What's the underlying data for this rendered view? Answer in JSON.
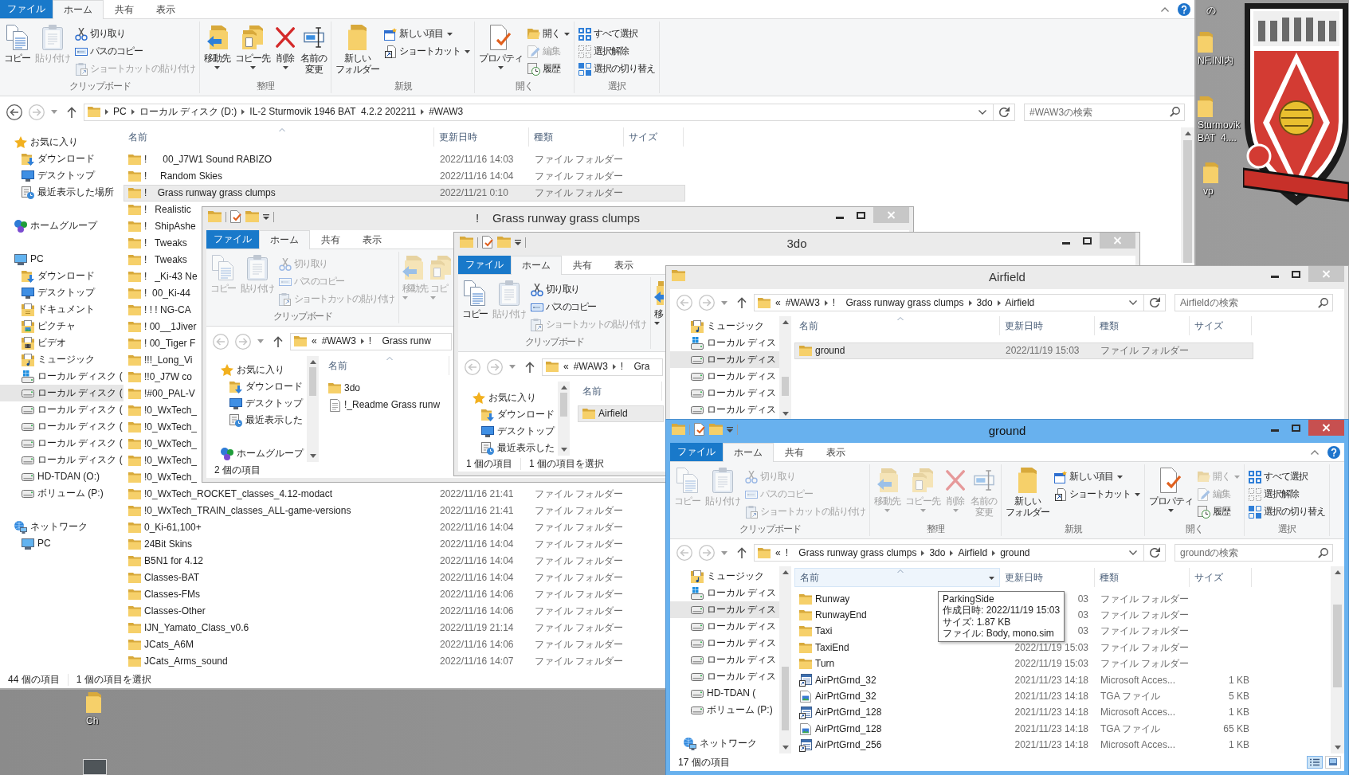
{
  "desktop": {
    "icons": [
      {
        "kind": "label",
        "label": "の"
      },
      {
        "kind": "folder",
        "label": "NF.INI内"
      },
      {
        "kind": "folder",
        "label": "Sturmovik\nBAT  4...."
      },
      {
        "kind": "folder",
        "label": "vp"
      },
      {
        "kind": "folder",
        "label": "Ch"
      },
      {
        "kind": "image"
      }
    ]
  },
  "windows": [
    {
      "active": false,
      "tabs": [
        {
          "kind": "file",
          "label": "ファイル",
          "selected": false
        },
        {
          "kind": "tab",
          "label": "ホーム",
          "selected": true
        },
        {
          "kind": "tab",
          "label": "共有",
          "selected": false
        },
        {
          "kind": "tab",
          "label": "表示",
          "selected": false
        }
      ],
      "ribbon": [
        {
          "label": "クリップボード",
          "items": [
            {
              "kind": "copy",
              "label": "コピー",
              "disabled": false
            },
            {
              "kind": "paste",
              "label": "貼り付け",
              "disabled": true
            },
            {
              "kind": "cut",
              "label": "切り取り",
              "disabled": false
            },
            {
              "kind": "copypath",
              "label": "パスのコピー",
              "disabled": false
            },
            {
              "kind": "pasteshortcut",
              "label": "ショートカットの貼り付け",
              "disabled": true
            }
          ]
        },
        {
          "label": "整理",
          "items": [
            {
              "kind": "moveto",
              "label": "移動先",
              "disabled": false
            },
            {
              "kind": "copyto",
              "label": "コピー先",
              "disabled": false
            },
            {
              "kind": "delete",
              "label": "削除",
              "disabled": false
            },
            {
              "kind": "rename",
              "lines": [
                "名前の",
                "変更"
              ],
              "disabled": false
            }
          ]
        },
        {
          "label": "新規",
          "items": [
            {
              "kind": "newfolder",
              "lines": [
                "新しい",
                "フォルダー"
              ],
              "disabled": false
            },
            {
              "kind": "newitem",
              "label": "新しい項目",
              "disabled": false
            },
            {
              "kind": "shortcut",
              "label": "ショートカット",
              "disabled": false
            }
          ]
        },
        {
          "label": "開く",
          "items": [
            {
              "kind": "properties",
              "label": "プロパティ",
              "disabled": false
            },
            {
              "kind": "open",
              "label": "開く",
              "disabled": false
            },
            {
              "kind": "edit",
              "label": "編集",
              "disabled": true
            },
            {
              "kind": "history",
              "label": "履歴",
              "disabled": false
            }
          ]
        },
        {
          "label": "選択",
          "items": [
            {
              "kind": "selectall",
              "label": "すべて選択",
              "disabled": false
            },
            {
              "kind": "selectnone",
              "label": "選択解除",
              "disabled": false
            },
            {
              "kind": "invert",
              "label": "選択の切り替え",
              "disabled": false
            }
          ]
        }
      ],
      "nav_buttons": [
        {
          "kind": "back",
          "disabled": false
        },
        {
          "kind": "forward",
          "disabled": true
        }
      ],
      "address": {
        "path": [
          "PC",
          "ローカル ディスク (D:)",
          "IL-2 Sturmovik 1946 BAT  4.2.2 202211",
          "#WAW3"
        ],
        "search_placeholder": "#WAW3の検索"
      },
      "nav": [
        {
          "label": "お気に入り",
          "kind": "favorites",
          "selected": false,
          "children": [
            {
              "label": "ダウンロード",
              "kind": "downloads",
              "selected": false
            },
            {
              "label": "デスクトップ",
              "kind": "desktop",
              "selected": false
            },
            {
              "label": "最近表示した場所",
              "kind": "recent",
              "selected": false
            }
          ]
        },
        {
          "label": "ホームグループ",
          "kind": "homegroup",
          "selected": false
        },
        {
          "label": "PC",
          "kind": "pc",
          "selected": false,
          "children": [
            {
              "label": "ダウンロード",
              "kind": "downloads",
              "selected": false
            },
            {
              "label": "デスクトップ",
              "kind": "desktop",
              "selected": false
            },
            {
              "label": "ドキュメント",
              "kind": "documents",
              "selected": false
            },
            {
              "label": "ピクチャ",
              "kind": "pictures",
              "selected": false
            },
            {
              "label": "ビデオ",
              "kind": "videos",
              "selected": false
            },
            {
              "label": "ミュージック",
              "kind": "music",
              "selected": false
            },
            {
              "label": "ローカル ディスク (",
              "kind": "sysdrive",
              "selected": false
            },
            {
              "label": "ローカル ディスク (",
              "kind": "drive",
              "selected": true
            },
            {
              "label": "ローカル ディスク (",
              "kind": "drive",
              "selected": false
            },
            {
              "label": "ローカル ディスク (",
              "kind": "drive",
              "selected": false
            },
            {
              "label": "ローカル ディスク (",
              "kind": "drive",
              "selected": false
            },
            {
              "label": "ローカル ディスク (",
              "kind": "drive",
              "selected": false
            },
            {
              "label": "HD-TDAN (O:)",
              "kind": "drive",
              "selected": false
            },
            {
              "label": "ボリューム (P:)",
              "kind": "drive",
              "selected": false
            }
          ]
        },
        {
          "label": "ネットワーク",
          "kind": "network",
          "selected": false,
          "children": [
            {
              "label": "PC",
              "kind": "pc",
              "selected": false
            }
          ]
        }
      ],
      "columns": [
        {
          "label": "名前",
          "sorted": true
        },
        {
          "label": "更新日時",
          "sorted": false
        },
        {
          "label": "種類",
          "sorted": false
        },
        {
          "label": "サイズ",
          "sorted": false
        }
      ],
      "rows": [
        {
          "name": "!      00_J7W1 Sound RABIZO",
          "modified": "2022/11/16 14:03",
          "type": "ファイル フォルダー",
          "kind": "folder",
          "selected": false
        },
        {
          "name": "!     Random Skies",
          "modified": "2022/11/16 14:04",
          "type": "ファイル フォルダー",
          "kind": "folder",
          "selected": false
        },
        {
          "name": "!    Grass runway grass clumps",
          "modified": "2022/11/21 0:10",
          "type": "ファイル フォルダー",
          "kind": "folder",
          "selected": true
        },
        {
          "name": "!   Realistic",
          "kind": "folder",
          "selected": false
        },
        {
          "name": "!   ShipAshe",
          "kind": "folder",
          "selected": false
        },
        {
          "name": "!   Tweaks",
          "kind": "folder",
          "selected": false
        },
        {
          "name": "!   Tweaks",
          "kind": "folder",
          "selected": false
        },
        {
          "name": "!   _Ki-43 Ne",
          "kind": "folder",
          "selected": false
        },
        {
          "name": "!  00_Ki-44",
          "kind": "folder",
          "selected": false
        },
        {
          "name": "! ! ! NG-CA",
          "kind": "folder",
          "selected": false
        },
        {
          "name": "! 00__1Jiver",
          "kind": "folder",
          "selected": false
        },
        {
          "name": "! 00_Tiger F",
          "kind": "folder",
          "selected": false
        },
        {
          "name": "!!!_Long_Vi",
          "kind": "folder",
          "selected": false
        },
        {
          "name": "!!0_J7W co",
          "kind": "folder",
          "selected": false
        },
        {
          "name": "!#00_PAL-V",
          "kind": "folder",
          "selected": false
        },
        {
          "name": "!0_WxTech_",
          "kind": "folder",
          "selected": false
        },
        {
          "name": "!0_WxTech_",
          "kind": "folder",
          "selected": false
        },
        {
          "name": "!0_WxTech_",
          "kind": "folder",
          "selected": false
        },
        {
          "name": "!0_WxTech_",
          "kind": "folder",
          "selected": false
        },
        {
          "name": "!0_WxTech_",
          "kind": "folder",
          "selected": false
        },
        {
          "name": "!0_WxTech_ROCKET_classes_4.12-modact",
          "modified": "2022/11/16 21:41",
          "type": "ファイル フォルダー",
          "kind": "folder",
          "selected": false
        },
        {
          "name": "!0_WxTech_TRAIN_classes_ALL-game-versions",
          "modified": "2022/11/16 21:41",
          "type": "ファイル フォルダー",
          "kind": "folder",
          "selected": false
        },
        {
          "name": "0_Ki-61,100+",
          "modified": "2022/11/16 14:04",
          "type": "ファイル フォルダー",
          "kind": "folder",
          "selected": false
        },
        {
          "name": "24Bit Skins",
          "modified": "2022/11/16 14:04",
          "type": "ファイル フォルダー",
          "kind": "folder",
          "selected": false
        },
        {
          "name": "B5N1 for 4.12",
          "modified": "2022/11/16 14:04",
          "type": "ファイル フォルダー",
          "kind": "folder",
          "selected": false
        },
        {
          "name": "Classes-BAT",
          "modified": "2022/11/16 14:04",
          "type": "ファイル フォルダー",
          "kind": "folder",
          "selected": false
        },
        {
          "name": "Classes-FMs",
          "modified": "2022/11/16 14:06",
          "type": "ファイル フォルダー",
          "kind": "folder",
          "selected": false
        },
        {
          "name": "Classes-Other",
          "modified": "2022/11/16 14:06",
          "type": "ファイル フォルダー",
          "kind": "folder",
          "selected": false
        },
        {
          "name": "IJN_Yamato_Class_v0.6",
          "modified": "2022/11/19 21:14",
          "type": "ファイル フォルダー",
          "kind": "folder",
          "selected": false
        },
        {
          "name": "JCats_A6M",
          "modified": "2022/11/16 14:06",
          "type": "ファイル フォルダー",
          "kind": "folder",
          "selected": false
        },
        {
          "name": "JCats_Arms_sound",
          "modified": "2022/11/16 14:07",
          "type": "ファイル フォルダー",
          "kind": "folder",
          "selected": false
        }
      ],
      "status": [
        "44 個の項目",
        "1 個の項目を選択"
      ]
    },
    {
      "title": "!    Grass runway grass clumps",
      "active": false,
      "tabs": [
        {
          "kind": "file",
          "label": "ファイル",
          "selected": false
        },
        {
          "kind": "tab",
          "label": "ホーム",
          "selected": true
        },
        {
          "kind": "tab",
          "label": "共有",
          "selected": false
        },
        {
          "kind": "tab",
          "label": "表示",
          "selected": false
        }
      ],
      "ribbon": [
        {
          "label": "クリップボード",
          "items": [
            {
              "kind": "copy",
              "label": "コピー",
              "disabled": true
            },
            {
              "kind": "paste",
              "label": "貼り付け",
              "disabled": true
            },
            {
              "kind": "cut",
              "label": "切り取り",
              "disabled": true
            },
            {
              "kind": "copypath",
              "label": "パスのコピー",
              "disabled": true
            },
            {
              "kind": "pasteshortcut",
              "label": "ショートカットの貼り付け",
              "disabled": true
            }
          ]
        },
        {
          "items": [
            {
              "kind": "moveto",
              "label": "移動先",
              "disabled": true
            },
            {
              "kind": "copyto",
              "label": "コピ",
              "disabled": true
            }
          ]
        }
      ],
      "nav_buttons": [
        {
          "kind": "back",
          "disabled": true
        },
        {
          "kind": "forward",
          "disabled": true
        }
      ],
      "address": {
        "overflow": "«",
        "path": [
          "#WAW3",
          "!    Grass runw"
        ]
      },
      "nav": [
        {
          "label": "お気に入り",
          "kind": "favorites",
          "selected": false,
          "children": [
            {
              "label": "ダウンロード",
              "kind": "downloads",
              "selected": false
            },
            {
              "label": "デスクトップ",
              "kind": "desktop",
              "selected": false
            },
            {
              "label": "最近表示した",
              "kind": "recent",
              "selected": false
            }
          ]
        },
        {
          "label": "ホームグループ",
          "kind": "homegroup",
          "selected": false
        }
      ],
      "columns": [
        {
          "label": "名前",
          "sorted": true
        }
      ],
      "rows": [
        {
          "name": "3do",
          "kind": "folder",
          "selected": false
        },
        {
          "name": "!_Readme Grass runw",
          "kind": "text",
          "selected": false
        }
      ],
      "status": [
        "2 個の項目"
      ]
    },
    {
      "title": "3do",
      "active": false,
      "tabs": [
        {
          "kind": "file",
          "label": "ファイル",
          "selected": false
        },
        {
          "kind": "tab",
          "label": "ホーム",
          "selected": true
        },
        {
          "kind": "tab",
          "label": "共有",
          "selected": false
        },
        {
          "kind": "tab",
          "label": "表示",
          "selected": false
        }
      ],
      "ribbon": [
        {
          "label": "クリップボード",
          "items": [
            {
              "kind": "copy",
              "label": "コピー",
              "disabled": false
            },
            {
              "kind": "paste",
              "label": "貼り付け",
              "disabled": true
            },
            {
              "kind": "cut",
              "label": "切り取り",
              "disabled": false
            },
            {
              "kind": "copypath",
              "label": "パスのコピー",
              "disabled": false
            },
            {
              "kind": "pasteshortcut",
              "label": "ショートカットの貼り付け",
              "disabled": true
            }
          ]
        },
        {
          "items": [
            {
              "kind": "moveto",
              "label": "移",
              "disabled": false
            }
          ]
        }
      ],
      "nav_buttons": [
        {
          "kind": "back",
          "disabled": true
        },
        {
          "kind": "forward",
          "disabled": true
        }
      ],
      "address": {
        "overflow": "«",
        "path": [
          "#WAW3",
          "!    Gra"
        ]
      },
      "nav": [
        {
          "label": "お気に入り",
          "kind": "favorites",
          "selected": false,
          "children": [
            {
              "label": "ダウンロード",
              "kind": "downloads",
              "selected": false
            },
            {
              "label": "デスクトップ",
              "kind": "desktop",
              "selected": false
            },
            {
              "label": "最近表示した",
              "kind": "recent",
              "selected": false
            }
          ]
        }
      ],
      "columns": [
        {
          "label": "名前"
        }
      ],
      "rows": [
        {
          "name": "Airfield",
          "kind": "folder",
          "selected": true
        }
      ],
      "status": [
        "1 個の項目",
        "1 個の項目を選択"
      ]
    },
    {
      "title": "Airfield",
      "active": false,
      "nav_buttons": [
        {
          "kind": "back",
          "disabled": true
        },
        {
          "kind": "forward",
          "disabled": true
        }
      ],
      "address": {
        "overflow": "«",
        "path": [
          "#WAW3",
          "!    Grass runway grass clumps",
          "3do",
          "Airfield"
        ],
        "search_placeholder": "Airfieldの検索"
      },
      "nav": [
        {
          "children": [
            {
              "label": "ミュージック",
              "kind": "music",
              "selected": false
            },
            {
              "label": "ローカル ディス",
              "kind": "sysdrive",
              "selected": false
            },
            {
              "label": "ローカル ディス",
              "kind": "drive",
              "selected": true
            },
            {
              "label": "ローカル ディス",
              "kind": "drive",
              "selected": false
            },
            {
              "label": "ローカル ディス",
              "kind": "drive",
              "selected": false
            },
            {
              "label": "ローカル ディス",
              "kind": "drive",
              "selected": false
            }
          ]
        }
      ],
      "columns": [
        {
          "label": "名前",
          "sorted": true
        },
        {
          "label": "更新日時",
          "sorted": false
        },
        {
          "label": "種類",
          "sorted": false
        },
        {
          "label": "サイズ",
          "sorted": false
        }
      ],
      "rows": [
        {
          "name": "ground",
          "modified": "2022/11/19 15:03",
          "type": "ファイル フォルダー",
          "kind": "folder",
          "selected": true
        }
      ]
    },
    {
      "title": "ground",
      "active": true,
      "tabs": [
        {
          "kind": "file",
          "label": "ファイル",
          "selected": false
        },
        {
          "kind": "tab",
          "label": "ホーム",
          "selected": true
        },
        {
          "kind": "tab",
          "label": "共有",
          "selected": false
        },
        {
          "kind": "tab",
          "label": "表示",
          "selected": false
        }
      ],
      "ribbon": [
        {
          "label": "クリップボード",
          "items": [
            {
              "kind": "copy",
              "label": "コピー",
              "disabled": true
            },
            {
              "kind": "paste",
              "label": "貼り付け",
              "disabled": true
            },
            {
              "kind": "cut",
              "label": "切り取り",
              "disabled": true
            },
            {
              "kind": "copypath",
              "label": "パスのコピー",
              "disabled": true
            },
            {
              "kind": "pasteshortcut",
              "label": "ショートカットの貼り付け",
              "disabled": true
            }
          ]
        },
        {
          "label": "整理",
          "items": [
            {
              "kind": "moveto",
              "label": "移動先",
              "disabled": true
            },
            {
              "kind": "copyto",
              "label": "コピー先",
              "disabled": true
            },
            {
              "kind": "delete",
              "label": "削除",
              "disabled": true
            },
            {
              "kind": "rename",
              "lines": [
                "名前の",
                "変更"
              ],
              "disabled": true
            }
          ]
        },
        {
          "label": "新規",
          "items": [
            {
              "kind": "newfolder",
              "lines": [
                "新しい",
                "フォルダー"
              ],
              "disabled": false
            },
            {
              "kind": "newitem",
              "label": "新しい項目",
              "disabled": false
            },
            {
              "kind": "shortcut",
              "label": "ショートカット",
              "disabled": false
            }
          ]
        },
        {
          "label": "開く",
          "items": [
            {
              "kind": "properties",
              "label": "プロパティ",
              "disabled": false
            },
            {
              "kind": "open",
              "label": "開く",
              "disabled": true
            },
            {
              "kind": "edit",
              "label": "編集",
              "disabled": true
            },
            {
              "kind": "history",
              "label": "履歴",
              "disabled": false
            }
          ]
        },
        {
          "label": "選択",
          "items": [
            {
              "kind": "selectall",
              "label": "すべて選択",
              "disabled": false
            },
            {
              "kind": "selectnone",
              "label": "選択解除",
              "disabled": false
            },
            {
              "kind": "invert",
              "label": "選択の切り替え",
              "disabled": false
            }
          ]
        }
      ],
      "nav_buttons": [
        {
          "kind": "back",
          "disabled": true
        },
        {
          "kind": "forward",
          "disabled": true
        }
      ],
      "address": {
        "overflow": "«",
        "path": [
          "!    Grass runway grass clumps",
          "3do",
          "Airfield",
          "ground"
        ],
        "search_placeholder": "groundの検索"
      },
      "nav": [
        {
          "children": [
            {
              "label": "ミュージック",
              "kind": "music",
              "selected": false
            },
            {
              "label": "ローカル ディス",
              "kind": "sysdrive",
              "selected": false
            },
            {
              "label": "ローカル ディス",
              "kind": "drive",
              "selected": true
            },
            {
              "label": "ローカル ディス",
              "kind": "drive",
              "selected": false
            },
            {
              "label": "ローカル ディス",
              "kind": "drive",
              "selected": false
            },
            {
              "label": "ローカル ディス",
              "kind": "drive",
              "selected": false
            },
            {
              "label": "ローカル ディス",
              "kind": "drive",
              "selected": false
            },
            {
              "label": "HD-TDAN (",
              "kind": "drive",
              "selected": false
            },
            {
              "label": "ボリューム (P:)",
              "kind": "drive",
              "selected": false
            }
          ]
        },
        {
          "label": "ネットワーク",
          "kind": "network",
          "selected": false
        }
      ],
      "columns": [
        {
          "label": "名前",
          "sorted": true,
          "hovered": true
        },
        {
          "label": "更新日時",
          "sorted": false,
          "hovered": false
        },
        {
          "label": "種類",
          "sorted": false,
          "hovered": false
        },
        {
          "label": "サイズ",
          "sorted": false,
          "hovered": false
        }
      ],
      "rows": [
        {
          "name": "Runway",
          "modified": "03",
          "type": "ファイル フォルダー",
          "kind": "folder",
          "selected": false
        },
        {
          "name": "RunwayEnd",
          "modified": "03",
          "type": "ファイル フォルダー",
          "kind": "folder",
          "selected": false
        },
        {
          "name": "Taxi",
          "modified": "03",
          "type": "ファイル フォルダー",
          "kind": "folder",
          "selected": false
        },
        {
          "name": "TaxiEnd",
          "modified": "2022/11/19 15:03",
          "type": "ファイル フォルダー",
          "kind": "folder",
          "selected": false
        },
        {
          "name": "Turn",
          "modified": "2022/11/19 15:03",
          "type": "ファイル フォルダー",
          "kind": "folder",
          "selected": false
        },
        {
          "name": "AirPrtGrnd_32",
          "modified": "2021/11/23 14:18",
          "type": "Microsoft Acces...",
          "size": "1 KB",
          "kind": "access",
          "selected": false
        },
        {
          "name": "AirPrtGrnd_32",
          "modified": "2021/11/23 14:18",
          "type": "TGA ファイル",
          "size": "5 KB",
          "kind": "tga",
          "selected": false
        },
        {
          "name": "AirPrtGrnd_128",
          "modified": "2021/11/23 14:18",
          "type": "Microsoft Acces...",
          "size": "1 KB",
          "kind": "access",
          "selected": false
        },
        {
          "name": "AirPrtGrnd_128",
          "modified": "2021/11/23 14:18",
          "type": "TGA ファイル",
          "size": "65 KB",
          "kind": "tga",
          "selected": false
        },
        {
          "name": "AirPrtGrnd_256",
          "modified": "2021/11/23 14:18",
          "type": "Microsoft Acces...",
          "size": "1 KB",
          "kind": "access",
          "selected": false
        }
      ],
      "tooltip": [
        "ParkingSide",
        "作成日時: 2022/11/19 15:03",
        "サイズ: 1.87 KB",
        "ファイル: Body, mono.sim"
      ],
      "status": [
        "17 個の項目"
      ],
      "view_buttons": [
        {
          "kind": "details",
          "selected": true
        },
        {
          "kind": "large",
          "selected": false
        }
      ]
    }
  ]
}
